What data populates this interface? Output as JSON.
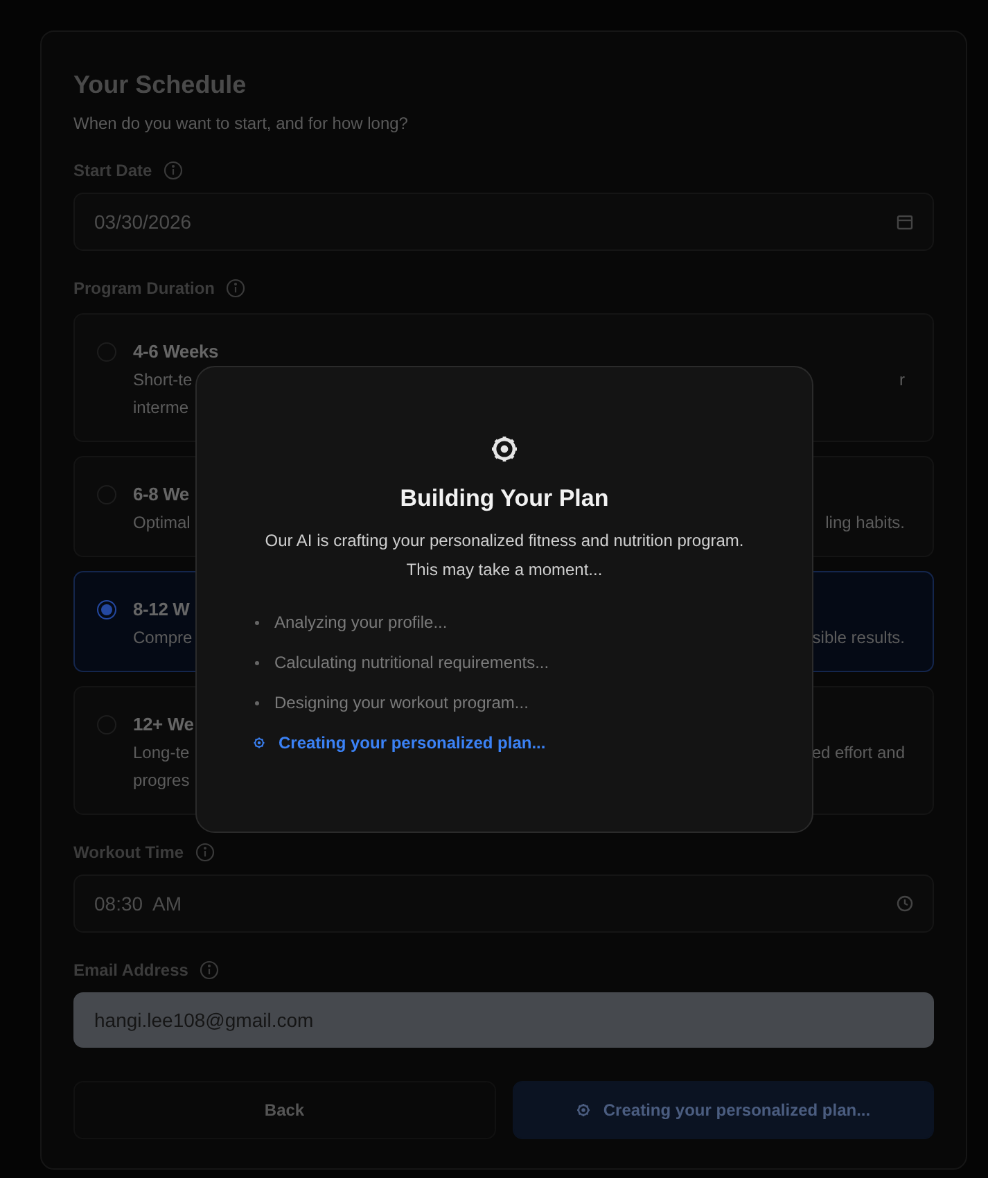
{
  "form": {
    "title": "Your Schedule",
    "subtitle": "When do you want to start, and for how long?",
    "start_date": {
      "label": "Start Date",
      "value": "03/30/2026"
    },
    "duration": {
      "label": "Program Duration",
      "options": [
        {
          "title": "4-6 Weeks",
          "lines": [
            {
              "left": "Short-te",
              "right": "r"
            },
            {
              "left": "interme"
            }
          ],
          "selected": false
        },
        {
          "title": "6-8 We",
          "lines": [
            {
              "left": "Optimal",
              "right": "ling habits."
            }
          ],
          "selected": false
        },
        {
          "title": "8-12 W",
          "lines": [
            {
              "left": "Compre",
              "right": "sible results."
            }
          ],
          "selected": true
        },
        {
          "title": "12+ We",
          "lines": [
            {
              "left": "Long-te",
              "right": "ed effort and"
            },
            {
              "left": "progres"
            }
          ],
          "selected": false
        }
      ]
    },
    "workout_time": {
      "label": "Workout Time",
      "value": "08:30  AM"
    },
    "email": {
      "label": "Email Address",
      "value": "hangi.lee108@gmail.com"
    },
    "buttons": {
      "back": "Back",
      "submit": "Creating your personalized plan..."
    }
  },
  "modal": {
    "title": "Building Your Plan",
    "description": [
      "Our AI is crafting your personalized fitness and nutrition program.",
      "This may take a moment..."
    ],
    "steps": [
      {
        "text": "Analyzing your profile...",
        "active": false
      },
      {
        "text": "Calculating nutritional requirements...",
        "active": false
      },
      {
        "text": "Designing your workout program...",
        "active": false
      },
      {
        "text": "Creating your personalized plan...",
        "active": true
      }
    ]
  }
}
